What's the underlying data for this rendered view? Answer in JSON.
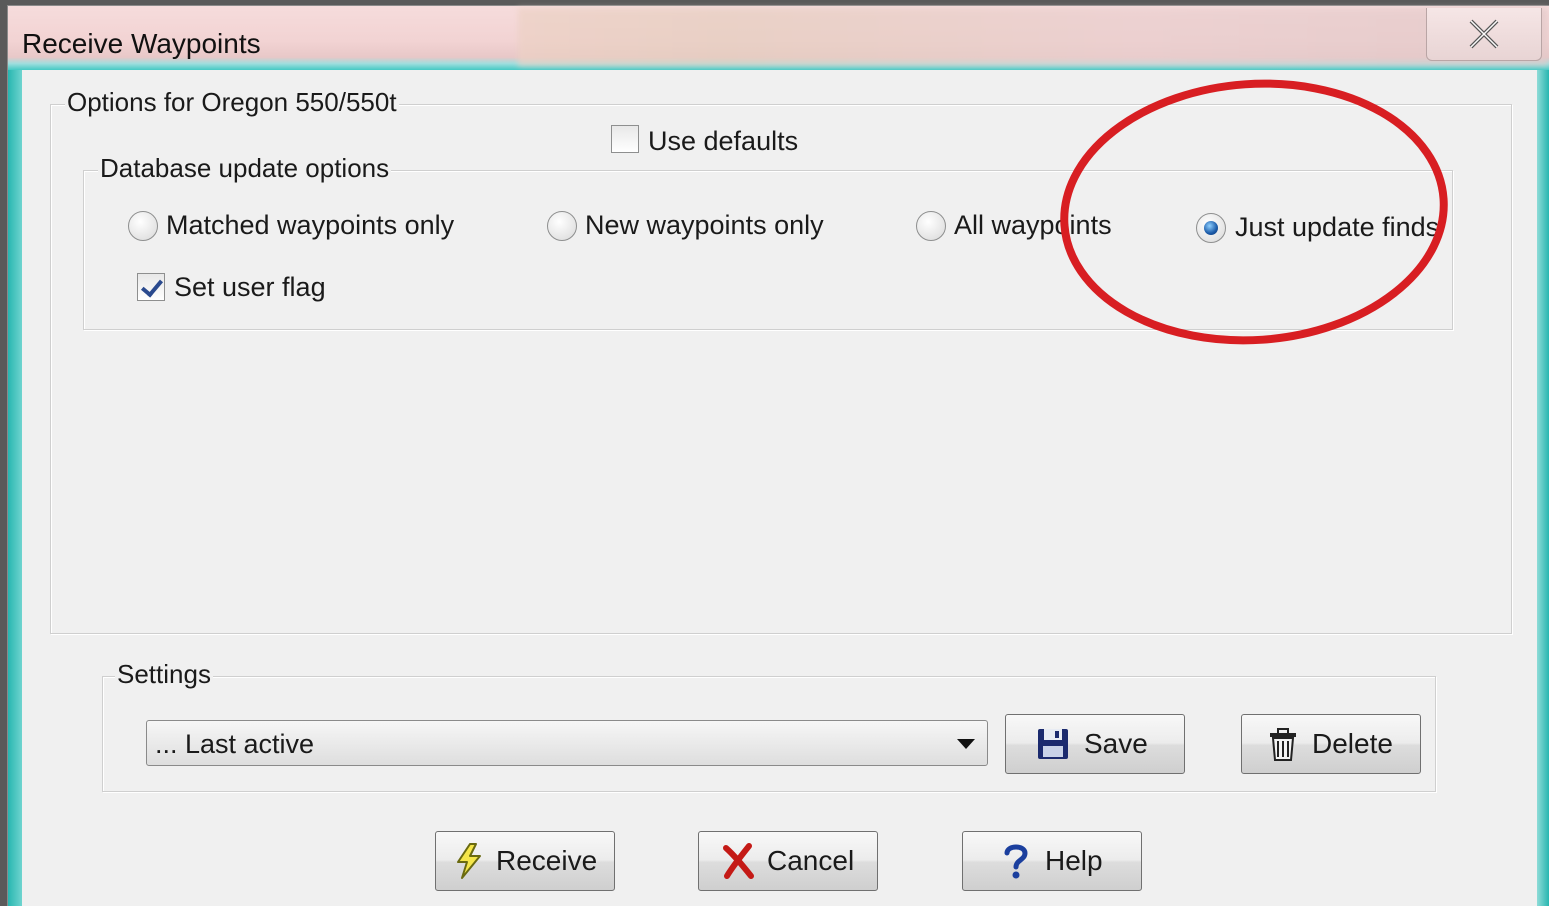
{
  "window": {
    "title": "Receive Waypoints"
  },
  "options_group": {
    "label": "Options for Oregon 550/550t",
    "use_defaults": {
      "label": "Use defaults",
      "checked": false
    }
  },
  "database_group": {
    "label": "Database update options",
    "radios": [
      {
        "label": "Matched waypoints only",
        "selected": false
      },
      {
        "label": "New waypoints only",
        "selected": false
      },
      {
        "label": "All waypoints",
        "selected": false
      },
      {
        "label": "Just update finds",
        "selected": true
      }
    ],
    "set_user_flag": {
      "label": "Set user flag",
      "checked": true
    }
  },
  "settings_group": {
    "label": "Settings",
    "selected_value": "... Last active",
    "save_label": "Save",
    "delete_label": "Delete"
  },
  "actions": {
    "receive_label": "Receive",
    "cancel_label": "Cancel",
    "help_label": "Help"
  },
  "colors": {
    "annotation_circle": "#d81e22",
    "title_accent": "#45c9c4"
  },
  "icons": [
    "close-icon",
    "floppy-disk-icon",
    "trash-can-icon",
    "lightning-icon",
    "red-x-icon",
    "question-mark-icon"
  ]
}
